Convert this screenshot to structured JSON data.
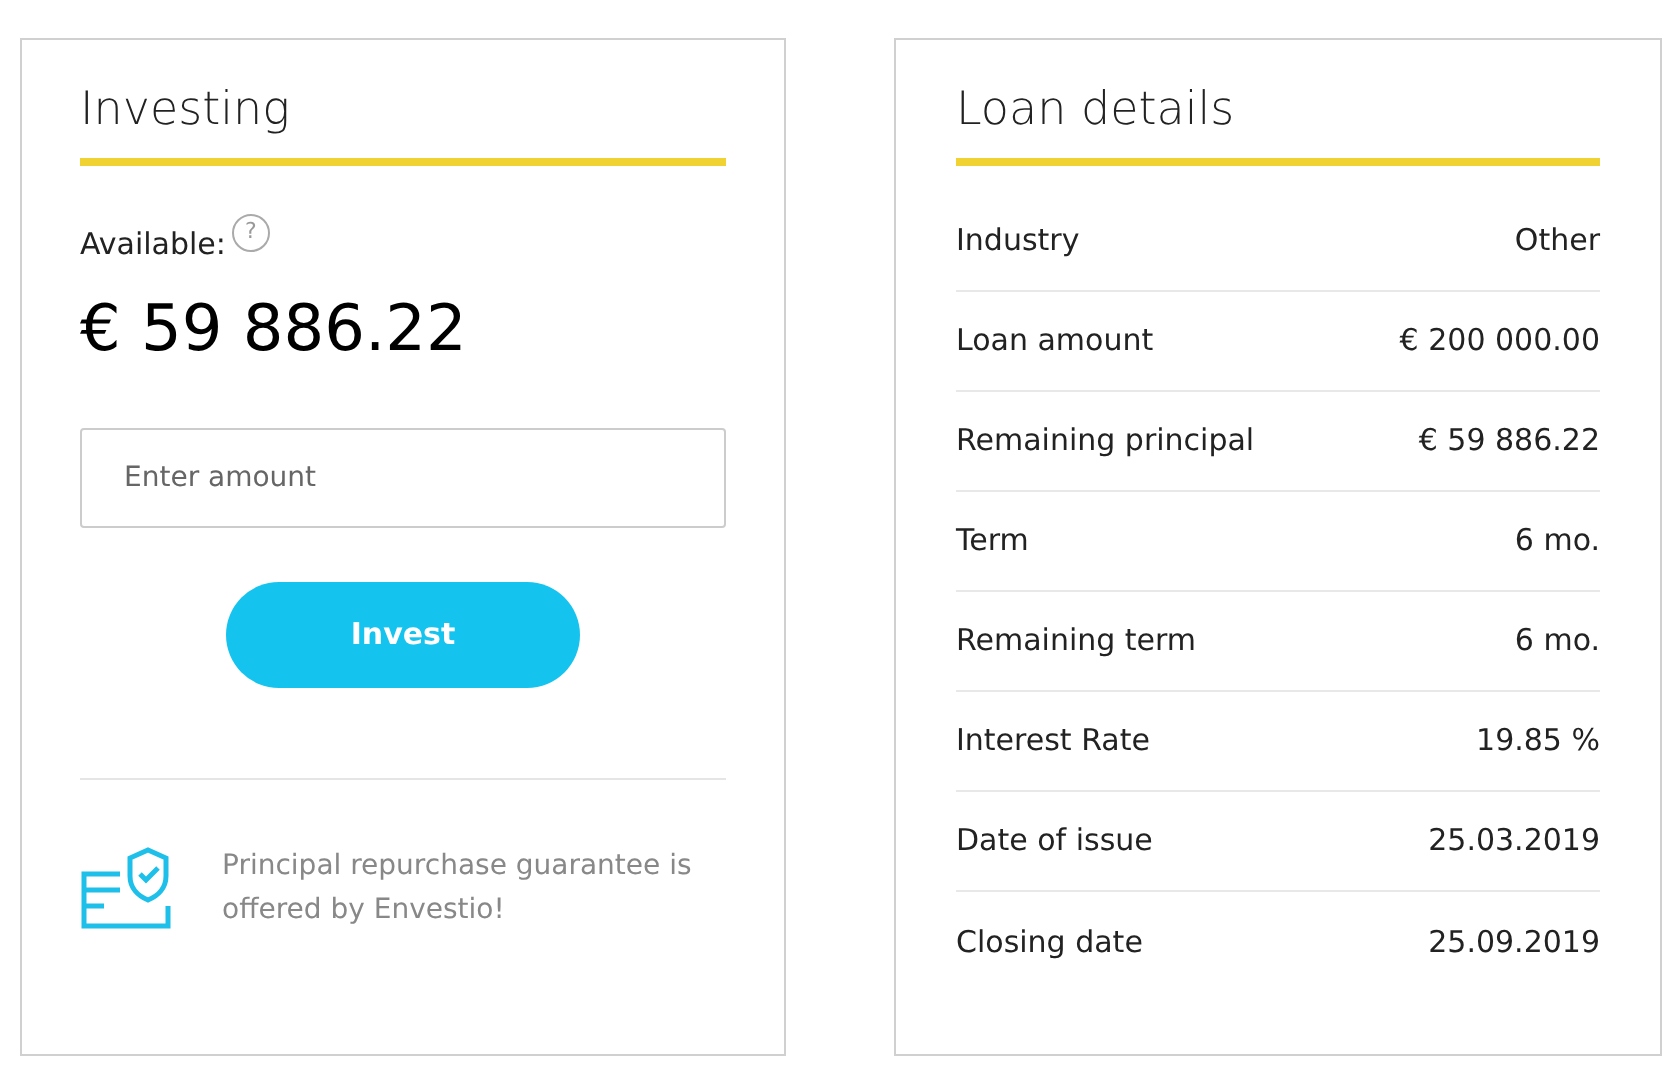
{
  "investing": {
    "title": "Investing",
    "available_label": "Available:",
    "help_icon": "?",
    "amount": "€ 59 886.22",
    "amount_field": {
      "placeholder": "Enter amount"
    },
    "invest_button": "Invest",
    "guarantee_text": "Principal repurchase guarantee is offered by Envestio!"
  },
  "loan_details": {
    "title": "Loan details",
    "rows": [
      {
        "label": "Industry",
        "value": "Other"
      },
      {
        "label": "Loan amount",
        "value": "€ 200 000.00"
      },
      {
        "label": "Remaining principal",
        "value": "€ 59 886.22"
      },
      {
        "label": "Term",
        "value": "6 mo."
      },
      {
        "label": "Remaining term",
        "value": "6 mo."
      },
      {
        "label": "Interest Rate",
        "value": "19.85 %"
      },
      {
        "label": "Date of issue",
        "value": "25.03.2019"
      },
      {
        "label": "Closing date",
        "value": "25.09.2019"
      }
    ]
  }
}
